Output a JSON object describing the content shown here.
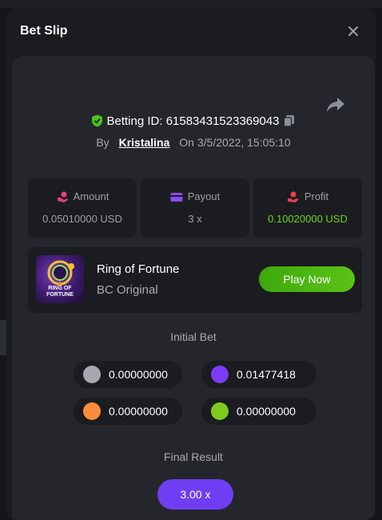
{
  "modal": {
    "title": "Bet Slip"
  },
  "bet": {
    "id_label": "Betting ID:",
    "id": "61583431523369043",
    "by_label": "By",
    "user": "Kristalina",
    "on_label": "On",
    "timestamp": "3/5/2022, 15:05:10"
  },
  "stats": {
    "amount": {
      "label": "Amount",
      "value": "0.05010000 USD"
    },
    "payout": {
      "label": "Payout",
      "value": "3 x"
    },
    "profit": {
      "label": "Profit",
      "value": "0.10020000 USD"
    }
  },
  "game": {
    "name": "Ring of Fortune",
    "provider": "BC Original",
    "play_label": "Play Now",
    "thumb_text_line1": "RING OF",
    "thumb_text_line2": "FORTUNE"
  },
  "initial_bet": {
    "label": "Initial Bet",
    "coins": [
      {
        "color": "#a5a8ae",
        "amount": "0.00000000"
      },
      {
        "color": "#7c3cf6",
        "amount": "0.01477418"
      },
      {
        "color": "#ff8c3a",
        "amount": "0.00000000"
      },
      {
        "color": "#7ecb20",
        "amount": "0.00000000"
      }
    ]
  },
  "final_result": {
    "label": "Final Result",
    "value": "3.00 x"
  },
  "colors": {
    "accent": "#6f3ef3",
    "green": "#6bd21b",
    "play": "#4db512"
  }
}
